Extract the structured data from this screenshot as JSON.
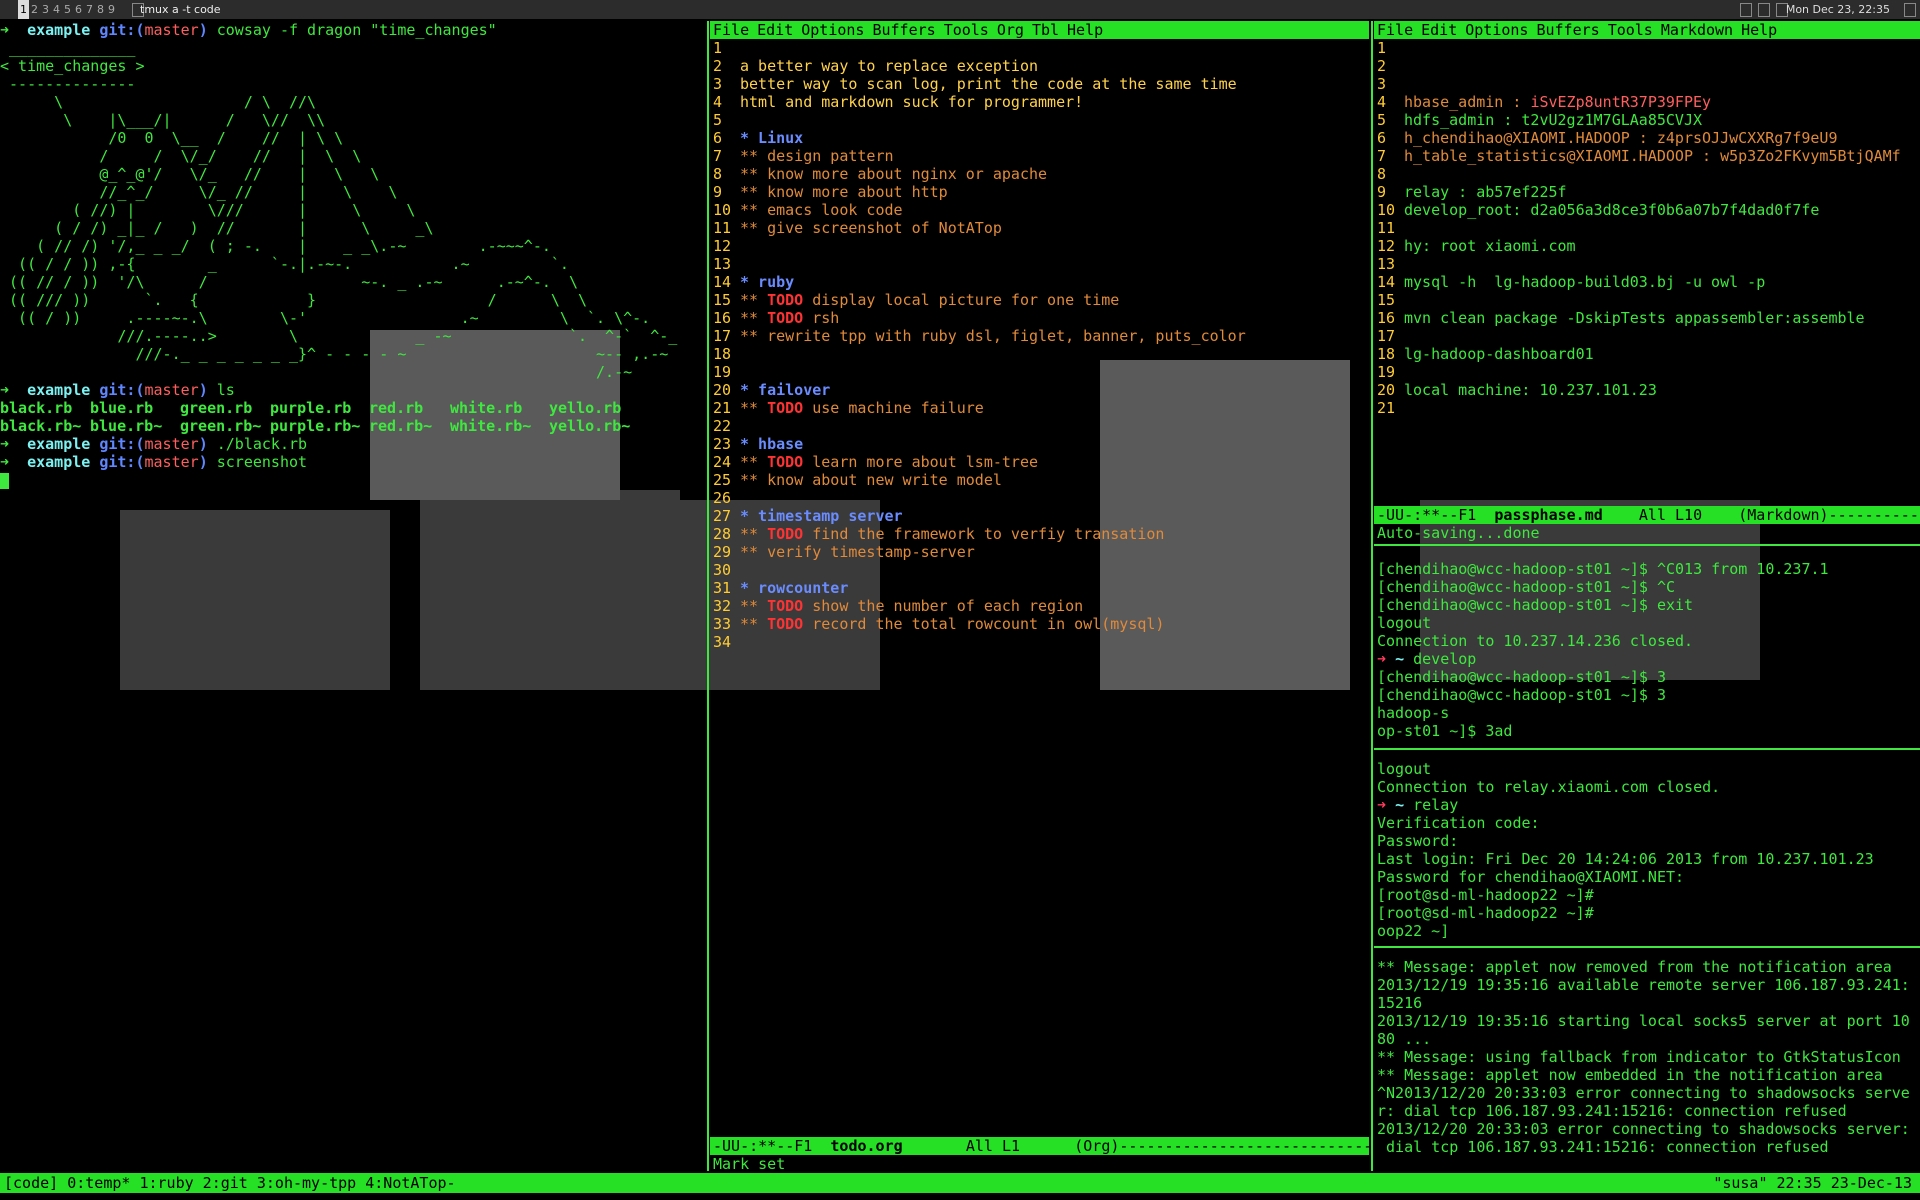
{
  "topbar": {
    "tags": [
      "1",
      "2",
      "3",
      "4",
      "5",
      "6",
      "7",
      "8",
      "9"
    ],
    "window_title": "tmux a -t code",
    "clock": "Mon Dec 23, 22:35"
  },
  "left_terminal": {
    "lines": [
      {
        "type": "prompt",
        "dir": "example",
        "git": "git:(",
        "branch": "master",
        "close": ")",
        "cmd": " cowsay -f dragon \"time_changes\""
      },
      {
        "type": "cow",
        "text": " ______________"
      },
      {
        "type": "cow",
        "text": "< time_changes >"
      },
      {
        "type": "cow",
        "text": " --------------"
      },
      {
        "type": "cow",
        "text": "      \\                    / \\  //\\"
      },
      {
        "type": "cow",
        "text": "       \\    |\\___/|      /   \\//  \\\\"
      },
      {
        "type": "cow",
        "text": "            /0  0  \\__  /    //  | \\ \\"
      },
      {
        "type": "cow",
        "text": "           /     /  \\/_/    //   |  \\  \\"
      },
      {
        "type": "cow",
        "text": "           @_^_@'/   \\/_   //    |   \\   \\"
      },
      {
        "type": "cow",
        "text": "           //_^_/     \\/_ //     |    \\    \\"
      },
      {
        "type": "cow",
        "text": "        ( //) |        \\///      |     \\     \\"
      },
      {
        "type": "cow",
        "text": "      ( / /) _|_ /   )  //       |      \\     _\\"
      },
      {
        "type": "cow",
        "text": "    ( // /) '/,_ _ _/  ( ; -.    |    _ _\\.-~        .-~~~^-."
      },
      {
        "type": "cow",
        "text": "  (( / / )) ,-{        _      `-.|.-~-.           .~         `."
      },
      {
        "type": "cow",
        "text": " (( // / ))  '/\\      /                 ~-. _ .-~      .-~^-.  \\"
      },
      {
        "type": "cow",
        "text": " (( /// ))      `.   {            }                   /      \\  \\"
      },
      {
        "type": "cow",
        "text": "  (( / ))     .----~-.\\        \\-'                 .~         \\  `. \\^-."
      },
      {
        "type": "cow",
        "text": "             ///.----..>        \\             _ -~             `.  ^-`  ^-_"
      },
      {
        "type": "cow",
        "text": "               ///-._ _ _ _ _ _ _}^ - - - - ~                     ~-- ,.-~"
      },
      {
        "type": "cow",
        "text": "                                                                  /.-~"
      },
      {
        "type": "prompt",
        "dir": "example",
        "git": "git:(",
        "branch": "master",
        "close": ")",
        "cmd": " ls"
      },
      {
        "type": "files",
        "items": [
          "black.rb",
          "blue.rb",
          "green.rb",
          "purple.rb",
          "red.rb",
          "white.rb",
          "yello.rb"
        ]
      },
      {
        "type": "files",
        "items": [
          "black.rb~",
          "blue.rb~",
          "green.rb~",
          "purple.rb~",
          "red.rb~",
          "white.rb~",
          "yello.rb~"
        ]
      },
      {
        "type": "prompt",
        "dir": "example",
        "git": "git:(",
        "branch": "master",
        "close": ")",
        "cmd": " ./black.rb"
      },
      {
        "type": "prompt",
        "dir": "example",
        "git": "git:(",
        "branch": "master",
        "close": ")",
        "cmd": " screenshot"
      }
    ]
  },
  "mid_editor": {
    "menu": [
      "File",
      "Edit",
      "Options",
      "Buffers",
      "Tools",
      "Org",
      "Tbl",
      "Help"
    ],
    "lines": [
      {
        "n": "1",
        "parts": []
      },
      {
        "n": "2",
        "parts": [
          {
            "c": "plain",
            "t": "a better way to replace exception"
          }
        ]
      },
      {
        "n": "3",
        "parts": [
          {
            "c": "plain",
            "t": "better way to scan log, print the code at the same time"
          }
        ]
      },
      {
        "n": "4",
        "parts": [
          {
            "c": "plain",
            "t": "html and markdown suck for programmer!"
          }
        ]
      },
      {
        "n": "5",
        "parts": []
      },
      {
        "n": "6",
        "parts": [
          {
            "c": "org1",
            "t": "* Linux"
          }
        ]
      },
      {
        "n": "7",
        "parts": [
          {
            "c": "orgtxt",
            "t": "** design pattern"
          }
        ]
      },
      {
        "n": "8",
        "parts": [
          {
            "c": "orgtxt",
            "t": "** know more about nginx or apache"
          }
        ]
      },
      {
        "n": "9",
        "parts": [
          {
            "c": "orgtxt",
            "t": "** know more about http"
          }
        ]
      },
      {
        "n": "10",
        "parts": [
          {
            "c": "orgtxt",
            "t": "** emacs look code"
          }
        ]
      },
      {
        "n": "11",
        "parts": [
          {
            "c": "orgtxt",
            "t": "** give screenshot of NotATop"
          }
        ]
      },
      {
        "n": "12",
        "parts": []
      },
      {
        "n": "13",
        "parts": []
      },
      {
        "n": "14",
        "parts": [
          {
            "c": "org1",
            "t": "* ruby"
          }
        ]
      },
      {
        "n": "15",
        "parts": [
          {
            "c": "orgtxt",
            "t": "** "
          },
          {
            "c": "todo",
            "t": "TODO"
          },
          {
            "c": "orgtxt",
            "t": " display local picture for one time"
          }
        ]
      },
      {
        "n": "16",
        "parts": [
          {
            "c": "orgtxt",
            "t": "** "
          },
          {
            "c": "todo",
            "t": "TODO"
          },
          {
            "c": "orgtxt",
            "t": " rsh"
          }
        ]
      },
      {
        "n": "17",
        "parts": [
          {
            "c": "orgtxt",
            "t": "** rewrite tpp with ruby dsl, figlet, banner, puts_color"
          }
        ]
      },
      {
        "n": "18",
        "parts": []
      },
      {
        "n": "19",
        "parts": []
      },
      {
        "n": "20",
        "parts": [
          {
            "c": "org1",
            "t": "* failover"
          }
        ]
      },
      {
        "n": "21",
        "parts": [
          {
            "c": "orgtxt",
            "t": "** "
          },
          {
            "c": "todo",
            "t": "TODO"
          },
          {
            "c": "orgtxt",
            "t": " use machine failure"
          }
        ]
      },
      {
        "n": "22",
        "parts": []
      },
      {
        "n": "23",
        "parts": [
          {
            "c": "org1",
            "t": "* hbase"
          }
        ]
      },
      {
        "n": "24",
        "parts": [
          {
            "c": "orgtxt",
            "t": "** "
          },
          {
            "c": "todo",
            "t": "TODO"
          },
          {
            "c": "orgtxt",
            "t": " learn more about lsm-tree"
          }
        ]
      },
      {
        "n": "25",
        "parts": [
          {
            "c": "orgtxt",
            "t": "** know about new write model"
          }
        ]
      },
      {
        "n": "26",
        "parts": []
      },
      {
        "n": "27",
        "parts": [
          {
            "c": "org1",
            "t": "* timestamp server"
          }
        ]
      },
      {
        "n": "28",
        "parts": [
          {
            "c": "orgtxt",
            "t": "** "
          },
          {
            "c": "todo",
            "t": "TODO"
          },
          {
            "c": "orgtxt",
            "t": " find the framework to verfiy transation"
          }
        ]
      },
      {
        "n": "29",
        "parts": [
          {
            "c": "orgtxt",
            "t": "** verify timestamp-server"
          }
        ]
      },
      {
        "n": "30",
        "parts": []
      },
      {
        "n": "31",
        "parts": [
          {
            "c": "org1",
            "t": "* rowcounter"
          }
        ]
      },
      {
        "n": "32",
        "parts": [
          {
            "c": "orgtxt",
            "t": "** "
          },
          {
            "c": "todo",
            "t": "TODO"
          },
          {
            "c": "orgtxt",
            "t": " show the number of each region"
          }
        ]
      },
      {
        "n": "33",
        "parts": [
          {
            "c": "orgtxt",
            "t": "** "
          },
          {
            "c": "todo",
            "t": "TODO"
          },
          {
            "c": "orgtxt",
            "t": " record the total rowcount in owl(mysql)"
          }
        ]
      },
      {
        "n": "34",
        "parts": []
      }
    ],
    "modeline_pre": "-UU-:**--F1  ",
    "modeline_file": "todo.org",
    "modeline_post": "       All L1      (Org)-------------------------------------------",
    "echo": "Mark set"
  },
  "right_editor": {
    "menu": [
      "File",
      "Edit",
      "Options",
      "Buffers",
      "Tools",
      "Markdown",
      "Help"
    ],
    "lines": [
      {
        "n": "1",
        "parts": []
      },
      {
        "n": "2",
        "parts": []
      },
      {
        "n": "3",
        "parts": []
      },
      {
        "n": "4",
        "parts": [
          {
            "c": "mdkey",
            "t": "hbase_admin : "
          },
          {
            "c": "br",
            "t": "iSvEZp8untR37P39FPEy"
          }
        ]
      },
      {
        "n": "5",
        "parts": [
          {
            "c": "mdtext",
            "t": "hdfs_admin : t2vU2gz1M7GLAa85CVJX"
          }
        ]
      },
      {
        "n": "6",
        "parts": [
          {
            "c": "mdkey",
            "t": "h_chendihao@XIAOMI.HADOOP : z4prsOJJwCXXRg7f9eU9"
          }
        ]
      },
      {
        "n": "7",
        "parts": [
          {
            "c": "mdkey",
            "t": "h_table_statistics@XIAOMI.HADOOP : w5p3Zo2FKvym5BtjQAMf"
          }
        ]
      },
      {
        "n": "8",
        "parts": []
      },
      {
        "n": "9",
        "parts": [
          {
            "c": "mdtext",
            "t": "relay : ab57ef225f"
          }
        ]
      },
      {
        "n": "10",
        "parts": [
          {
            "c": "mdtext",
            "t": "develop_root: d2a056a3d8ce3f0b6a07b7f4dad0f7fe"
          }
        ]
      },
      {
        "n": "11",
        "parts": []
      },
      {
        "n": "12",
        "parts": [
          {
            "c": "mdtext",
            "t": "hy: root xiaomi.com"
          }
        ]
      },
      {
        "n": "13",
        "parts": []
      },
      {
        "n": "14",
        "parts": [
          {
            "c": "mdtext",
            "t": "mysql -h  lg-hadoop-build03.bj -u owl -p"
          }
        ]
      },
      {
        "n": "15",
        "parts": []
      },
      {
        "n": "16",
        "parts": [
          {
            "c": "mdtext",
            "t": "mvn clean package -DskipTests appassembler:assemble"
          }
        ]
      },
      {
        "n": "17",
        "parts": []
      },
      {
        "n": "18",
        "parts": [
          {
            "c": "mdtext",
            "t": "lg-hadoop-dashboard01"
          }
        ]
      },
      {
        "n": "19",
        "parts": []
      },
      {
        "n": "20",
        "parts": [
          {
            "c": "mdtext",
            "t": "local machine: 10.237.101.23"
          }
        ]
      },
      {
        "n": "21",
        "parts": []
      }
    ],
    "modeline_pre": "-UU-:**--F1  ",
    "modeline_file": "passphase.md",
    "modeline_post": "    All L10    (Markdown)----------",
    "echo": "Auto-saving...done"
  },
  "ssh_pane": {
    "lines": [
      "[chendihao@wcc-hadoop-st01 ~]$ ^C013 from 10.237.1",
      "[chendihao@wcc-hadoop-st01 ~]$ ^C",
      "[chendihao@wcc-hadoop-st01 ~]$ exit",
      "logout",
      "Connection to 10.237.14.236 closed.",
      {
        "prompt_arrow": "➜",
        "tilde": "~",
        "cmd": " develop"
      },
      "[chendihao@wcc-hadoop-st01 ~]$ 3",
      "[chendihao@wcc-hadoop-st01 ~]$ 3",
      "hadoop-s",
      "op-st01 ~]$ 3ad"
    ]
  },
  "relay_pane": {
    "lines": [
      "logout",
      "Connection to relay.xiaomi.com closed.",
      {
        "prompt_arrow": "➜",
        "tilde": "~",
        "cmd": " relay"
      },
      "Verification code:",
      "Password:",
      "Last login: Fri Dec 20 14:24:06 2013 from 10.237.101.23",
      "Password for chendihao@XIAOMI.NET:",
      "[root@sd-ml-hadoop22 ~]#",
      "[root@sd-ml-hadoop22 ~]#",
      "oop22 ~]"
    ]
  },
  "log_pane": {
    "lines": [
      "** Message: applet now removed from the notification area",
      "2013/12/19 19:35:16 available remote server 106.187.93.241:",
      "15216",
      "2013/12/19 19:35:16 starting local socks5 server at port 10",
      "80 ...",
      "** Message: using fallback from indicator to GtkStatusIcon",
      "** Message: applet now embedded in the notification area",
      "^N2013/12/20 20:33:03 error connecting to shadowsocks serve",
      "r: dial tcp 106.187.93.241:15216: connection refused",
      "2013/12/20 20:33:03 error connecting to shadowsocks server:",
      " dial tcp 106.187.93.241:15216: connection refused"
    ]
  },
  "tmux_status": {
    "left": "[code] 0:temp* 1:ruby  2:git  3:oh-my-tpp  4:NotATop-",
    "right": "\"susa\" 22:35 23-Dec-13"
  }
}
